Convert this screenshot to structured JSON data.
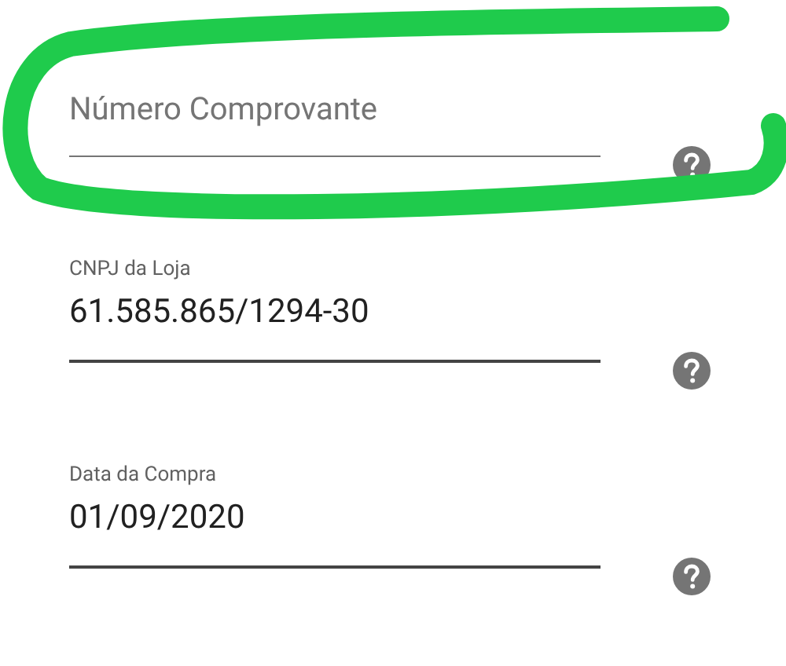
{
  "fields": [
    {
      "placeholder": "Número Comprovante",
      "highlighted": true
    },
    {
      "label": "CNPJ da Loja",
      "value": "61.585.865/1294-30",
      "highlighted": false
    },
    {
      "label": "Data da Compra",
      "value": "01/09/2020",
      "highlighted": false
    }
  ]
}
